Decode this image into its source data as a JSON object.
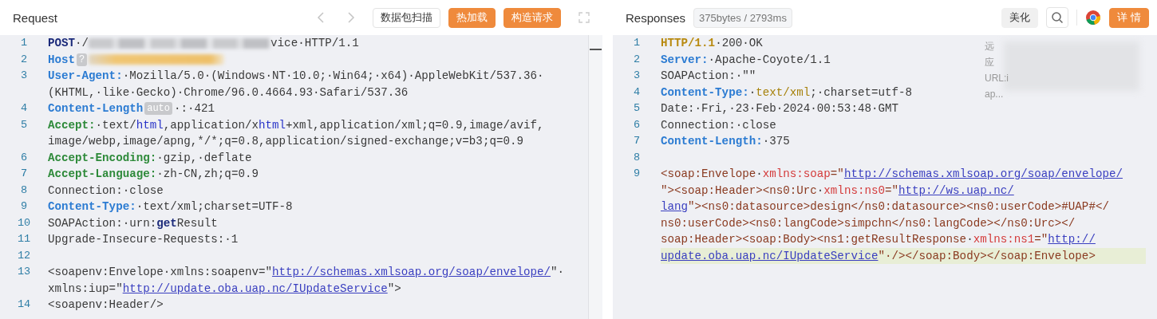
{
  "request": {
    "title": "Request",
    "buttons": [
      {
        "label": "数据包扫描",
        "kind": "outline"
      },
      {
        "label": "热加载",
        "kind": "primary"
      },
      {
        "label": "构造请求",
        "kind": "primary"
      }
    ],
    "lines": [
      {
        "num": "1",
        "rows": [
          {
            "highlighted": false,
            "segs": [
              {
                "kind": "keyword",
                "t": "POST"
              },
              {
                "kind": "plain",
                "t": "·/"
              },
              {
                "kind": "blur"
              },
              {
                "kind": "plain",
                "t": "vice·HTTP/1.1"
              }
            ]
          }
        ]
      },
      {
        "num": "2",
        "rows": [
          {
            "highlighted": false,
            "segs": [
              {
                "kind": "header",
                "t": "Host"
              },
              {
                "kind": "badge",
                "t": "?"
              },
              {
                "kind": "blur-warm"
              }
            ]
          }
        ]
      },
      {
        "num": "3",
        "rows": [
          {
            "highlighted": false,
            "segs": [
              {
                "kind": "header",
                "t": "User-Agent:"
              },
              {
                "kind": "plain",
                "t": "·Mozilla/5.0·(Windows·NT·10.0;·Win64;·x64)·AppleWebKit/537.36·"
              }
            ]
          },
          {
            "highlighted": false,
            "segs": [
              {
                "kind": "plain",
                "t": "(KHTML,·like·Gecko)·Chrome/96.0.4664.93·Safari/537.36"
              }
            ]
          }
        ]
      },
      {
        "num": "4",
        "rows": [
          {
            "highlighted": false,
            "segs": [
              {
                "kind": "header",
                "t": "Content-Length"
              },
              {
                "kind": "badge",
                "t": "auto"
              },
              {
                "kind": "plain",
                "t": "·:·421"
              }
            ]
          }
        ]
      },
      {
        "num": "5",
        "rows": [
          {
            "highlighted": false,
            "segs": [
              {
                "kind": "header-alt",
                "t": "Accept:"
              },
              {
                "kind": "plain",
                "t": "·text/"
              },
              {
                "kind": "html",
                "t": "html"
              },
              {
                "kind": "plain",
                "t": ",application/x"
              },
              {
                "kind": "html",
                "t": "html"
              },
              {
                "kind": "plain",
                "t": "+xml,application/xml;q=0.9,image/avif,"
              }
            ]
          },
          {
            "highlighted": false,
            "segs": [
              {
                "kind": "plain",
                "t": "image/webp,image/apng,*/*;q=0.8,application/signed-exchange;v=b3;q=0.9"
              }
            ]
          }
        ]
      },
      {
        "num": "6",
        "rows": [
          {
            "highlighted": false,
            "segs": [
              {
                "kind": "header-alt",
                "t": "Accept-Encoding:"
              },
              {
                "kind": "plain",
                "t": "·gzip,·deflate"
              }
            ]
          }
        ]
      },
      {
        "num": "7",
        "rows": [
          {
            "highlighted": false,
            "segs": [
              {
                "kind": "header-alt",
                "t": "Accept-Language:"
              },
              {
                "kind": "plain",
                "t": "·zh-CN,zh;q=0.9"
              }
            ]
          }
        ]
      },
      {
        "num": "8",
        "rows": [
          {
            "highlighted": false,
            "segs": [
              {
                "kind": "plain",
                "t": "Connection:·close"
              }
            ]
          }
        ]
      },
      {
        "num": "9",
        "rows": [
          {
            "highlighted": false,
            "segs": [
              {
                "kind": "header",
                "t": "Content-Type:"
              },
              {
                "kind": "plain",
                "t": "·text/xml;charset=UTF-8"
              }
            ]
          }
        ]
      },
      {
        "num": "10",
        "rows": [
          {
            "highlighted": false,
            "segs": [
              {
                "kind": "plain",
                "t": "SOAPAction:·urn:"
              },
              {
                "kind": "keyword",
                "t": "get"
              },
              {
                "kind": "plain",
                "t": "Result"
              }
            ]
          }
        ]
      },
      {
        "num": "11",
        "rows": [
          {
            "highlighted": false,
            "segs": [
              {
                "kind": "plain",
                "t": "Upgrade-Insecure-Requests:·1"
              }
            ]
          }
        ]
      },
      {
        "num": "12",
        "rows": [
          {
            "highlighted": false,
            "segs": []
          }
        ]
      },
      {
        "num": "13",
        "rows": [
          {
            "highlighted": false,
            "segs": [
              {
                "kind": "plain",
                "t": "<soapenv:Envelope·xmlns:soapenv=\""
              },
              {
                "kind": "url",
                "t": "http://schemas.xmlsoap.org/soap/envelope/"
              },
              {
                "kind": "plain",
                "t": "\"·"
              }
            ]
          },
          {
            "highlighted": false,
            "segs": [
              {
                "kind": "plain",
                "t": "xmlns:iup=\""
              },
              {
                "kind": "url",
                "t": "http://update.oba.uap.nc/IUpdateService"
              },
              {
                "kind": "plain",
                "t": "\">"
              }
            ]
          }
        ]
      },
      {
        "num": "14",
        "rows": [
          {
            "highlighted": false,
            "segs": [
              {
                "kind": "plain",
                "t": "<soapenv:Header/>"
              }
            ]
          }
        ]
      }
    ]
  },
  "response": {
    "title": "Responses",
    "stats": "375bytes / 2793ms",
    "buttons": [
      {
        "label": "美化",
        "kind": "grey"
      },
      {
        "label": "详 情",
        "kind": "primary"
      }
    ],
    "overlay": [
      "远",
      "应",
      "URL:i",
      "ap..."
    ],
    "lines": [
      {
        "num": "1",
        "rows": [
          {
            "highlighted": false,
            "segs": [
              {
                "kind": "status",
                "t": "HTTP/1.1"
              },
              {
                "kind": "plain",
                "t": "·200·OK"
              }
            ]
          }
        ]
      },
      {
        "num": "2",
        "rows": [
          {
            "highlighted": false,
            "segs": [
              {
                "kind": "header",
                "t": "Server:"
              },
              {
                "kind": "plain",
                "t": "·Apache-Coyote/1.1"
              }
            ]
          }
        ]
      },
      {
        "num": "3",
        "rows": [
          {
            "highlighted": false,
            "segs": [
              {
                "kind": "plain",
                "t": "SOAPAction:·\"\""
              }
            ]
          }
        ]
      },
      {
        "num": "4",
        "rows": [
          {
            "highlighted": false,
            "segs": [
              {
                "kind": "header",
                "t": "Content-Type:"
              },
              {
                "kind": "plain",
                "t": "·"
              },
              {
                "kind": "gold",
                "t": "text/xml"
              },
              {
                "kind": "plain",
                "t": ";·charset=utf-8"
              }
            ]
          }
        ]
      },
      {
        "num": "5",
        "rows": [
          {
            "highlighted": false,
            "segs": [
              {
                "kind": "plain",
                "t": "Date:·Fri,·23·Feb·2024·00:53:48·GMT"
              }
            ]
          }
        ]
      },
      {
        "num": "6",
        "rows": [
          {
            "highlighted": false,
            "segs": [
              {
                "kind": "plain",
                "t": "Connection:·close"
              }
            ]
          }
        ]
      },
      {
        "num": "7",
        "rows": [
          {
            "highlighted": false,
            "segs": [
              {
                "kind": "header",
                "t": "Content-Length:"
              },
              {
                "kind": "plain",
                "t": "·375"
              }
            ]
          }
        ]
      },
      {
        "num": "8",
        "rows": [
          {
            "highlighted": false,
            "segs": []
          }
        ]
      },
      {
        "num": "9",
        "rows": [
          {
            "highlighted": false,
            "segs": [
              {
                "kind": "tag",
                "t": "<soap:Envelope"
              },
              {
                "kind": "plain",
                "t": "·"
              },
              {
                "kind": "attr",
                "t": "xmlns:soap"
              },
              {
                "kind": "tag",
                "t": "=\""
              },
              {
                "kind": "url",
                "t": "http://schemas.xmlsoap.org/soap/envelope/"
              }
            ]
          },
          {
            "highlighted": false,
            "segs": [
              {
                "kind": "tag",
                "t": "\"><soap:Header><ns0:Urc"
              },
              {
                "kind": "plain",
                "t": "·"
              },
              {
                "kind": "attr",
                "t": "xmlns:ns0"
              },
              {
                "kind": "tag",
                "t": "=\""
              },
              {
                "kind": "url",
                "t": "http://ws.uap.nc/"
              }
            ]
          },
          {
            "highlighted": false,
            "segs": [
              {
                "kind": "url",
                "t": "lang"
              },
              {
                "kind": "tag",
                "t": "\"><ns0:datasource>design</ns0:datasource><ns0:userCode>#UAP#</"
              }
            ]
          },
          {
            "highlighted": false,
            "segs": [
              {
                "kind": "tag",
                "t": "ns0:userCode><ns0:langCode>simpchn</ns0:langCode></ns0:Urc></"
              }
            ]
          },
          {
            "highlighted": false,
            "segs": [
              {
                "kind": "tag",
                "t": "soap:Header><soap:Body><ns1:getResultResponse"
              },
              {
                "kind": "plain",
                "t": "·"
              },
              {
                "kind": "attr",
                "t": "xmlns:ns1"
              },
              {
                "kind": "tag",
                "t": "=\""
              },
              {
                "kind": "url",
                "t": "http://"
              }
            ]
          },
          {
            "highlighted": true,
            "segs": [
              {
                "kind": "url",
                "t": "update.oba.uap.nc/IUpdateService"
              },
              {
                "kind": "tag",
                "t": "\"·/></soap:Body></soap:Envelope>"
              }
            ]
          }
        ]
      }
    ]
  }
}
